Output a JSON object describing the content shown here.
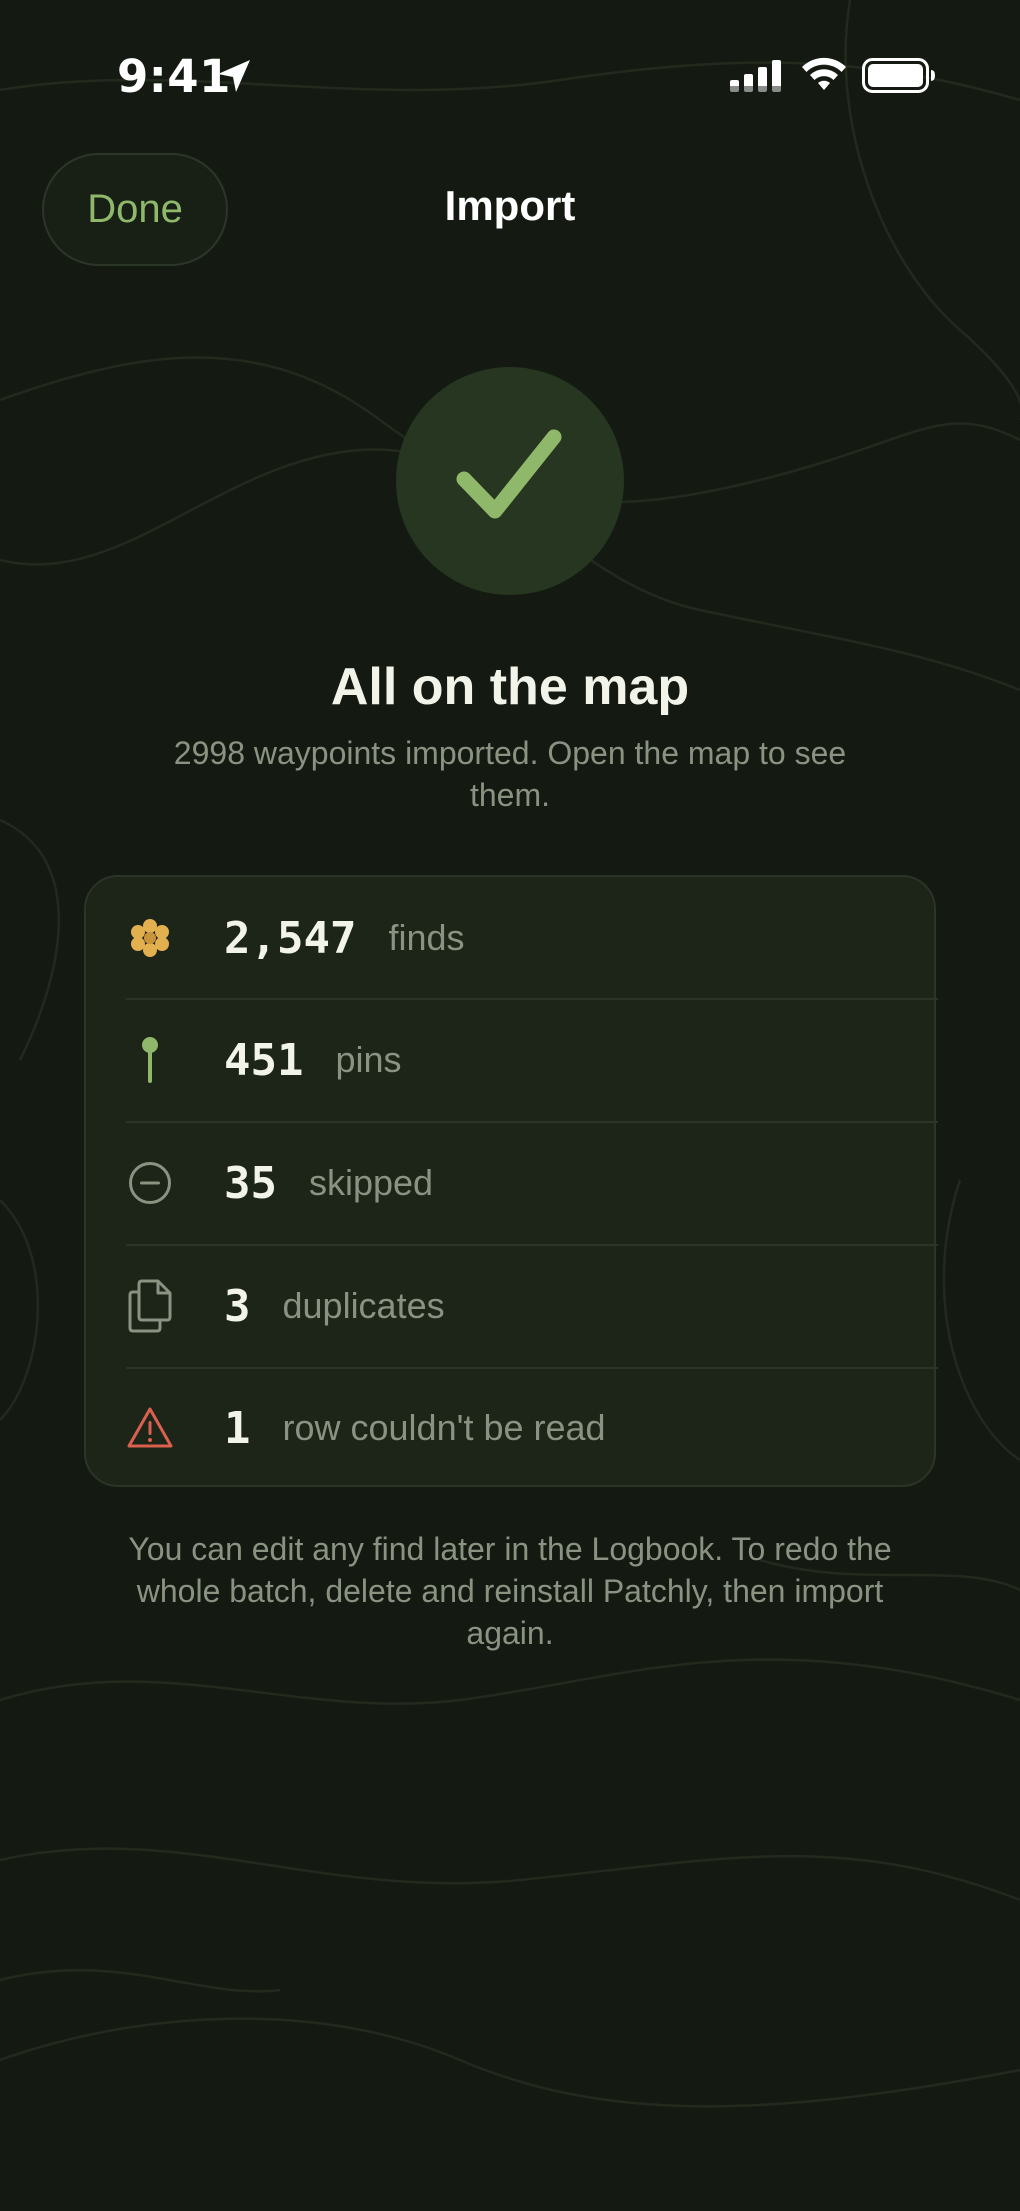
{
  "status_bar": {
    "time": "9:41",
    "location_icon": "location-arrow-icon",
    "signal_icon": "cellular-signal-icon",
    "wifi_icon": "wifi-icon",
    "battery_icon": "battery-full-icon"
  },
  "nav": {
    "done_label": "Done",
    "title": "Import"
  },
  "success": {
    "icon": "checkmark-icon",
    "headline": "All on the map",
    "message": "2998 waypoints imported. Open the map to see them."
  },
  "stats": [
    {
      "icon": "flower-icon",
      "count": "2,547",
      "label": "finds"
    },
    {
      "icon": "pin-icon",
      "count": "451",
      "label": "pins"
    },
    {
      "icon": "minus-circle-icon",
      "count": "35",
      "label": "skipped"
    },
    {
      "icon": "duplicate-documents-icon",
      "count": "3",
      "label": "duplicates"
    },
    {
      "icon": "warning-triangle-icon",
      "count": "1",
      "label": "row couldn't be read"
    }
  ],
  "footnote": "You can edit any find later in the Logbook. To redo the whole batch, delete and reinstall Patchly, then import again.",
  "colors": {
    "background": "#141a12",
    "accent_green": "#8fb86a",
    "gold": "#e2b04e",
    "warning_red": "#d9614e",
    "muted_text": "#8a9282"
  }
}
